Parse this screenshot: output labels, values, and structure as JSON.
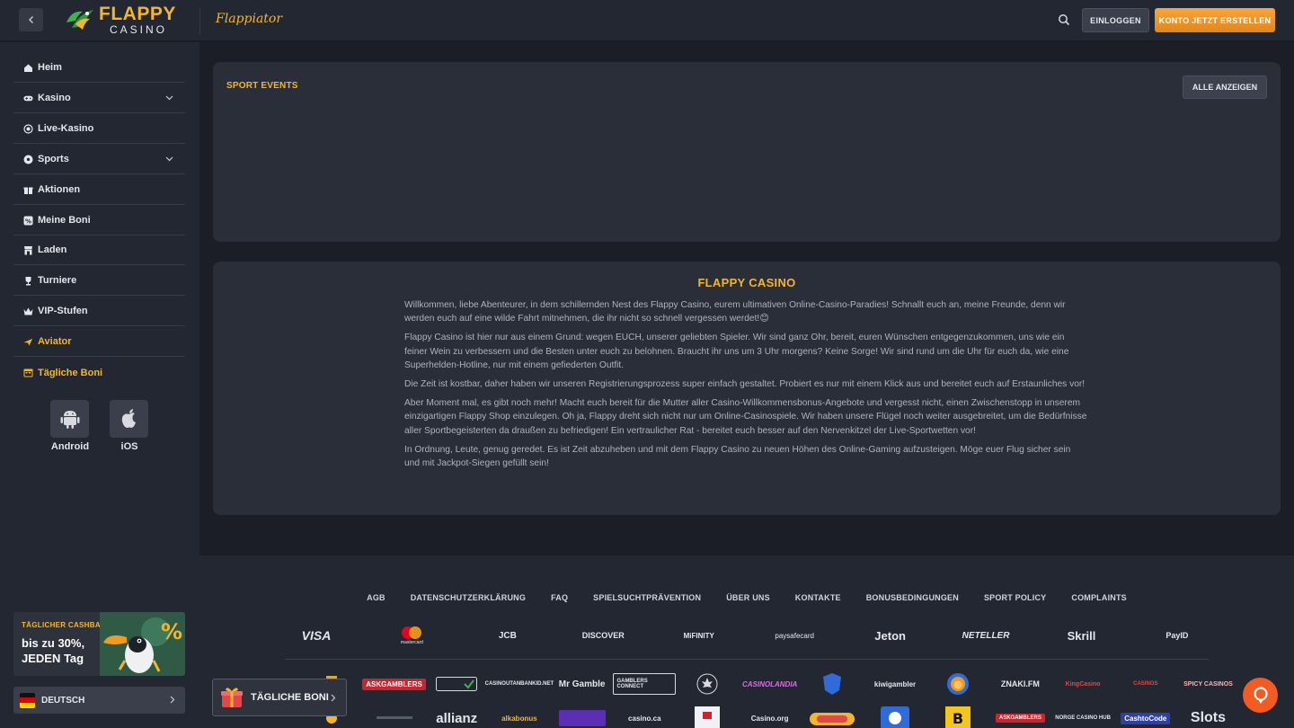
{
  "header": {
    "logo_line1": "FLAPPY",
    "logo_line2": "CASINO",
    "game_logo": "Flappiator",
    "login_label": "EINLOGGEN",
    "signup_label": "KONTO JETZT ERSTELLEN",
    "icons": {
      "back": "chevron-left-icon",
      "search": "search-icon"
    }
  },
  "sidebar": {
    "items": [
      {
        "label": "Heim",
        "icon": "home-icon"
      },
      {
        "label": "Kasino",
        "icon": "gamepad-icon",
        "expandable": true
      },
      {
        "label": "Live-Kasino",
        "icon": "live-icon"
      },
      {
        "label": "Sports",
        "icon": "soccer-ball-icon",
        "expandable": true
      },
      {
        "label": "Aktionen",
        "icon": "gift-icon"
      },
      {
        "label": "Meine Boni",
        "icon": "bonus-icon"
      },
      {
        "label": "Laden",
        "icon": "shop-icon"
      },
      {
        "label": "Turniere",
        "icon": "trophy-icon"
      },
      {
        "label": "VIP-Stufen",
        "icon": "crown-icon"
      },
      {
        "label": "Aviator",
        "icon": "plane-icon",
        "highlight": true
      },
      {
        "label": "Tägliche Boni",
        "icon": "calendar-icon",
        "highlight": true
      }
    ],
    "apps": [
      {
        "label": "Android",
        "icon": "android-icon"
      },
      {
        "label": "iOS",
        "icon": "apple-icon"
      }
    ],
    "cashback": {
      "title": "TÄGLICHER CASHBACK",
      "text": "bis zu 30%, JEDEN Tag"
    },
    "language": "DEUTSCH"
  },
  "sport_events": {
    "title": "SPORT EVENTS",
    "show_all": "ALLE ANZEIGEN"
  },
  "about": {
    "title": "FLAPPY CASINO",
    "paragraphs": [
      "Willkommen, liebe Abenteurer, in dem schillernden Nest des Flappy Casino, eurem ultimativen Online-Casino-Paradies! Schnallt euch an, meine Freunde, denn wir werden euch auf eine wilde Fahrt mitnehmen, die ihr nicht so schnell vergessen werdet!😊",
      "Flappy Casino ist hier nur aus einem Grund: wegen EUCH, unserer geliebten Spieler. Wir sind ganz Ohr, bereit, euren Wünschen entgegenzukommen, uns wie ein feiner Wein zu verbessern und die Besten unter euch zu belohnen. Braucht ihr uns um 3 Uhr morgens? Keine Sorge! Wir sind rund um die Uhr für euch da, wie eine Superhelden-Hotline, nur mit einem gefiederten Outfit.",
      "Die Zeit ist kostbar, daher haben wir unseren Registrierungsprozess super einfach gestaltet. Probiert es nur mit einem Klick aus und bereitet euch auf Erstaunliches vor!",
      "Aber Moment mal, es gibt noch mehr! Macht euch bereit für die Mutter aller Casino-Willkommensbonus-Angebote und vergesst nicht, einen Zwischenstopp in unserem einzigartigen Flappy Shop einzulegen. Oh ja, Flappy dreht sich nicht nur um Online-Casinospiele. Wir haben unsere Flügel noch weiter ausgebreitet, um die Bedürfnisse aller Sportbegeisterten da draußen zu befriedigen! Ein vertraulicher Rat - bereitet euch besser auf den Nervenkitzel der Live-Sportwetten vor!",
      "In Ordnung, Leute, genug geredet. Es ist Zeit abzuheben und mit dem Flappy Casino zu neuen Höhen des Online-Gaming aufzusteigen. Möge euer Flug sicher sein und mit Jackpot-Siegen gefüllt sein!"
    ]
  },
  "footer": {
    "links": [
      "AGB",
      "DATENSCHUTZERKLÄRUNG",
      "FAQ",
      "SPIELSUCHTPRÄVENTION",
      "ÜBER UNS",
      "KONTAKTE",
      "BONUSBEDINGUNGEN",
      "SPORT POLICY",
      "COMPLAINTS"
    ],
    "payments": [
      "VISA",
      "mastercard",
      "JCB",
      "DISCOVER",
      "MiFINITY",
      "paysafecard",
      "Jeton",
      "NETELLER",
      "Skrill",
      "PayID"
    ],
    "partners_row1": [
      "",
      "ASKGAMBLERS",
      "",
      "CASINOUTANBANKID.NET",
      "Mr Gamble",
      "GAMBLERS CONNECT",
      "",
      "CASINOLANDIA",
      "",
      "kiwigambler",
      "",
      "ZNAKI.FM",
      "KingCasino",
      "CASINOS",
      "SPICY CASINOS"
    ],
    "partners_row2": [
      "",
      "",
      "allianz",
      "alkabonus",
      "",
      "casino.ca",
      "",
      "Casino.org",
      "",
      "",
      "",
      "ASKGAMBLERS",
      "NORGE CASINO HUB",
      "CashtoCode",
      "Slots"
    ]
  },
  "floating": {
    "daily_bonus": "TÄGLICHE BONI"
  }
}
